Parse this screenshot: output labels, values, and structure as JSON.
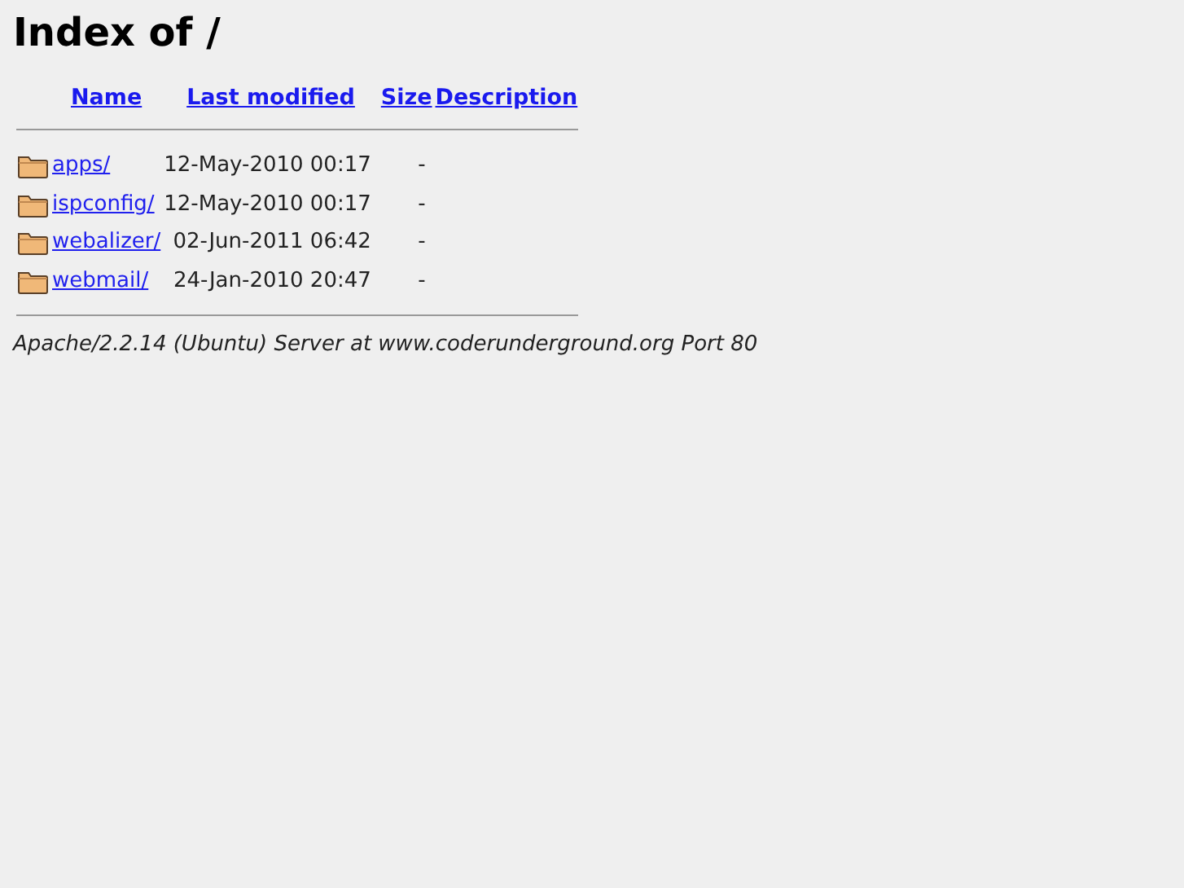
{
  "title": "Index of /",
  "table": {
    "columns": [
      "Name",
      "Last modified",
      "Size",
      "Description"
    ],
    "rows": [
      {
        "name": "apps/",
        "modified": "12-May-2010 00:17",
        "size": "-"
      },
      {
        "name": "ispconfig/",
        "modified": "12-May-2010 00:17",
        "size": "-"
      },
      {
        "name": "webalizer/",
        "modified": "02-Jun-2011 06:42",
        "size": "-"
      },
      {
        "name": "webmail/",
        "modified": "24-Jan-2010 20:47",
        "size": "-"
      }
    ]
  },
  "footer": "Apache/2.2.14 (Ubuntu) Server at www.coderunderground.org Port 80"
}
